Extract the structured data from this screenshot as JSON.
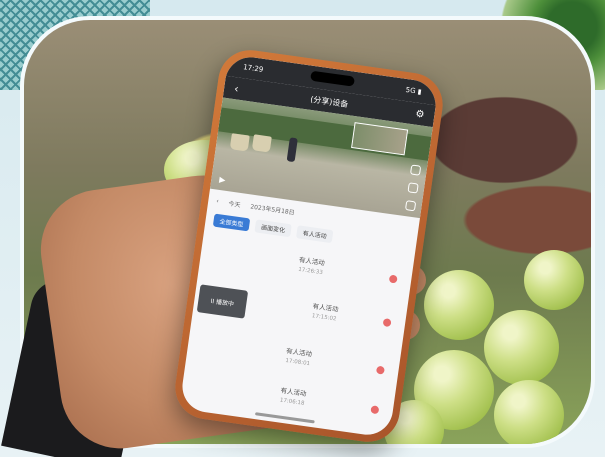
{
  "phone": {
    "status_time": "17:29",
    "status_right": "5G ▮",
    "title": "(分享)设备",
    "date_label": "今天",
    "date_range": "2023年5月18日",
    "filters": [
      {
        "label": "全部类型",
        "active": true
      },
      {
        "label": "画面变化",
        "active": false
      },
      {
        "label": "有人活动",
        "active": false
      }
    ],
    "events": [
      {
        "label": "有人活动",
        "time": "17:26:33"
      },
      {
        "label": "有人活动",
        "time": "17:15:02"
      },
      {
        "label": "有人活动",
        "time": "17:08:01"
      },
      {
        "label": "有人活动",
        "time": "17:06:18"
      }
    ],
    "thumb_label": "II 播放中"
  },
  "colors": {
    "accent": "#3a7bd5",
    "phone_case": "#c86b32",
    "event_dot": "#e86a6a"
  }
}
